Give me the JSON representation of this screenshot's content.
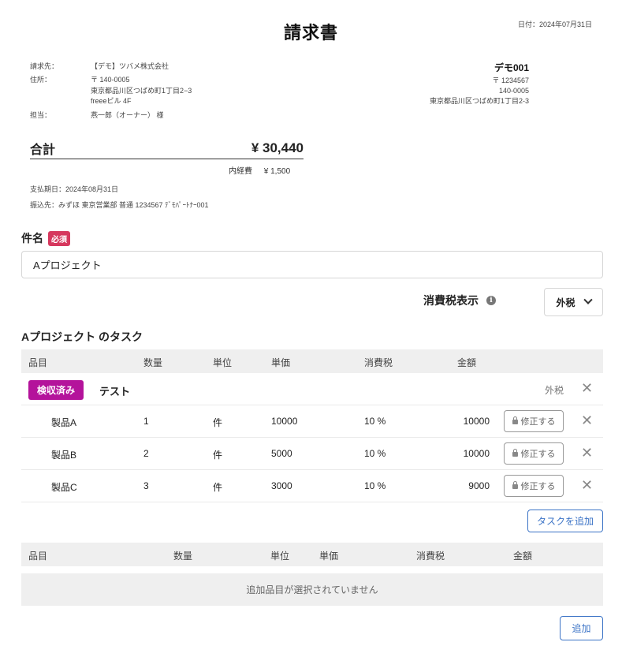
{
  "invoice": {
    "title": "請求書",
    "date": "日付：2024年07月31日",
    "billing_to": {
      "label_client": "請求先：",
      "client": "【デモ】ツバメ株式会社",
      "label_address": "住所：",
      "postal": "〒 140-0005",
      "address1": "東京都品川区つばめ町1丁目2−3",
      "address2": "freeeビル 4F",
      "label_contact": "担当：",
      "contact": "燕一郎（オーナー） 様"
    },
    "sender": {
      "name": "デモ001",
      "postal": "〒 1234567",
      "line2": "140-0005",
      "line3": "東京都品川区つばめ町1丁目2-3"
    },
    "total_label": "合計",
    "total_value": "¥ 30,440",
    "inner_expense_label": "内経費",
    "inner_expense_value": "¥ 1,500",
    "due_date": "支払期日：2024年08月31日",
    "bank": "振込先：みずほ 東京営業部 普通 1234567 ﾃﾞﾓﾊﾟｰﾄﾅｰ001"
  },
  "form": {
    "subject_label": "件名",
    "required_badge": "必須",
    "subject_value": "Aプロジェクト",
    "tax_display_label": "消費税表示",
    "tax_select_value": "外税",
    "task_heading": "Aプロジェクト のタスク"
  },
  "task_table": {
    "headers": [
      "品目",
      "数量",
      "単位",
      "単価",
      "消費税",
      "金額"
    ],
    "group": {
      "badge": "検収済み",
      "name": "テスト",
      "tax_mode": "外税"
    },
    "rows": [
      {
        "item": "製品A",
        "qty": "1",
        "unit": "件",
        "price": "10000",
        "tax": "10 %",
        "amount": "10000",
        "edit": "修正する"
      },
      {
        "item": "製品B",
        "qty": "2",
        "unit": "件",
        "price": "5000",
        "tax": "10 %",
        "amount": "10000",
        "edit": "修正する"
      },
      {
        "item": "製品C",
        "qty": "3",
        "unit": "件",
        "price": "3000",
        "tax": "10 %",
        "amount": "9000",
        "edit": "修正する"
      }
    ],
    "add_task_button": "タスクを追加"
  },
  "extra_table": {
    "headers": [
      "品目",
      "数量",
      "単位",
      "単価",
      "消費税",
      "金額"
    ],
    "empty_message": "追加品目が選択されていません",
    "add_button": "追加"
  },
  "colors": {
    "badge_purple": "#b4139b",
    "required_red": "#d6385e",
    "link_blue": "#3b73c6"
  },
  "icons": {
    "info": "info-circle-icon",
    "close": "close-icon",
    "lock": "lock-icon",
    "chevron": "chevron-down-icon"
  }
}
